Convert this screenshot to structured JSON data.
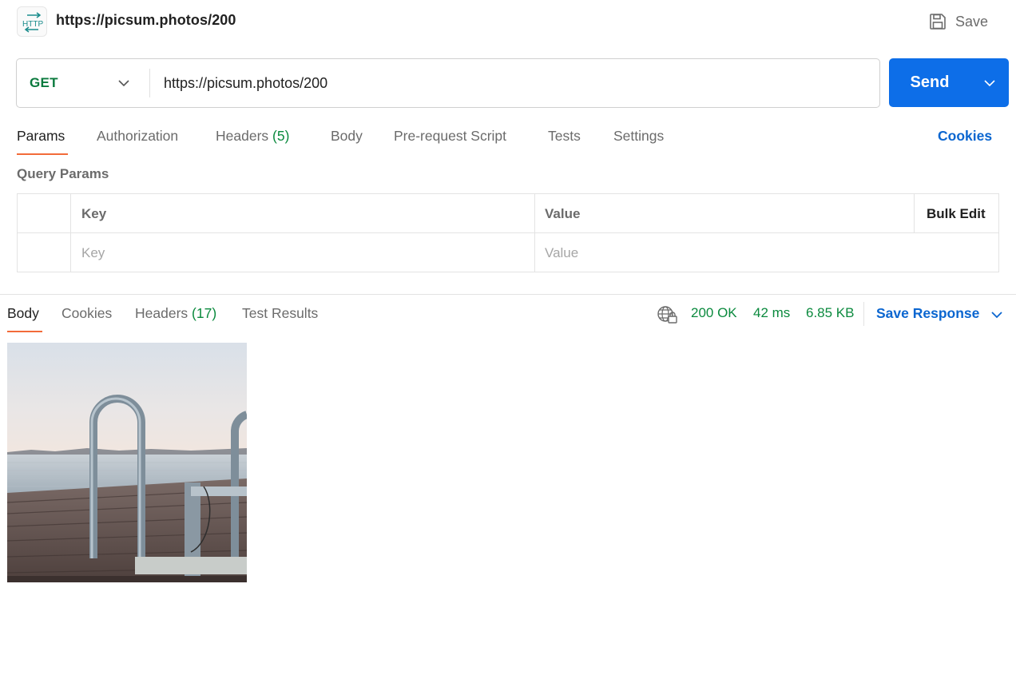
{
  "request": {
    "title": "https://picsum.photos/200",
    "save_label": "Save",
    "method": "GET",
    "url": "https://picsum.photos/200",
    "send_label": "Send"
  },
  "request_tabs": {
    "params": "Params",
    "authorization": "Authorization",
    "headers": "Headers",
    "headers_count": "(5)",
    "body": "Body",
    "prerequest": "Pre-request Script",
    "tests": "Tests",
    "settings": "Settings",
    "cookies": "Cookies"
  },
  "query_params": {
    "section_label": "Query Params",
    "col_key": "Key",
    "col_value": "Value",
    "bulk_edit": "Bulk Edit",
    "key_placeholder": "Key",
    "value_placeholder": "Value"
  },
  "response_tabs": {
    "body": "Body",
    "cookies": "Cookies",
    "headers": "Headers",
    "headers_count": "(17)",
    "test_results": "Test Results"
  },
  "response_meta": {
    "status": "200 OK",
    "time": "42 ms",
    "size": "6.85 KB",
    "save_response": "Save Response"
  },
  "colors": {
    "accent_blue": "#0d6ee8",
    "link_blue": "#0b66d0",
    "method_green": "#0b7a3e",
    "status_green": "#0b8a3e",
    "active_tab_underline": "#f26b3a"
  },
  "icons": {
    "http": "http-request-icon",
    "save": "floppy-disk-icon",
    "method_dropdown": "chevron-down-icon",
    "send_dropdown": "chevron-down-icon",
    "network": "globe-lock-icon",
    "save_response_dropdown": "chevron-down-icon"
  }
}
